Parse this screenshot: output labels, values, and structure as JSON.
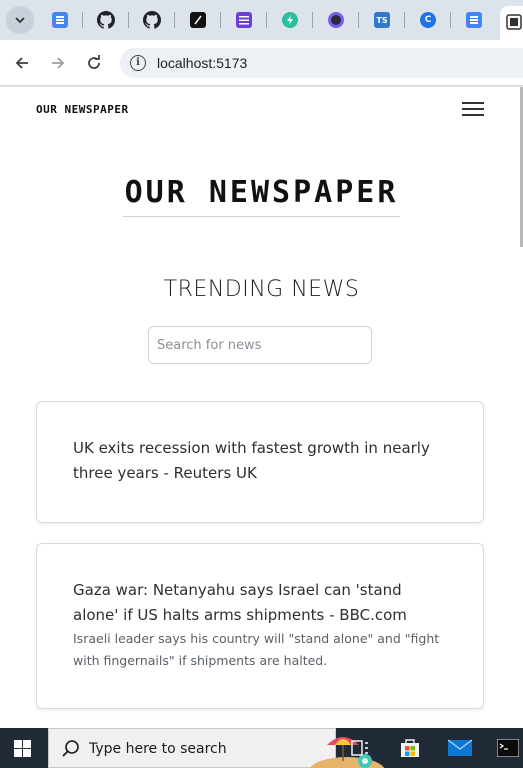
{
  "browser": {
    "tabs": [
      {
        "icon": "google-docs-icon"
      },
      {
        "icon": "github-icon"
      },
      {
        "icon": "github-icon"
      },
      {
        "icon": "notion-like-icon"
      },
      {
        "icon": "forms-list-icon"
      },
      {
        "icon": "bolt-app-icon"
      },
      {
        "icon": "circle-app-icon"
      },
      {
        "icon": "typescript-icon",
        "label": "TS"
      },
      {
        "icon": "c-app-icon",
        "label": "C"
      },
      {
        "icon": "google-docs-icon"
      }
    ],
    "url": "localhost:5173"
  },
  "page": {
    "nav_brand": "OUR NEWSPAPER",
    "masthead": "OUR NEWSPAPER",
    "section_title": "TRENDING NEWS",
    "search": {
      "placeholder": "Search for news",
      "value": ""
    },
    "articles": [
      {
        "title": "UK exits recession with fastest growth in nearly three years - Reuters UK",
        "description": ""
      },
      {
        "title": "Gaza war: Netanyahu says Israel can 'stand alone' if US halts arms shipments - BBC.com",
        "description": "Israeli leader says his country will \"stand alone\" and \"fight with fingernails\" if shipments are halted."
      }
    ]
  },
  "taskbar": {
    "search_placeholder": "Type here to search",
    "apps": [
      "task-view-icon",
      "microsoft-store-icon",
      "mail-icon",
      "terminal-icon"
    ]
  },
  "colors": {
    "tab_strip": "#dde3ea",
    "taskbar": "#1f2a36",
    "card_border": "#d8dbdf"
  }
}
